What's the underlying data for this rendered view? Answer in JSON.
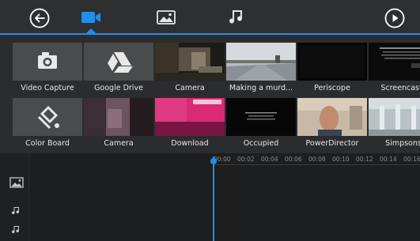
{
  "header": {
    "accent_color": "#1f8fe8",
    "back_icon": "arrow-left-circle-icon",
    "play_icon": "play-circle-icon",
    "tabs": [
      {
        "icon": "video-camera-icon",
        "active": true
      },
      {
        "icon": "image-icon",
        "active": false
      },
      {
        "icon": "music-note-icon",
        "active": false
      }
    ]
  },
  "library": {
    "items": [
      {
        "label": "Video Capture",
        "icon": "camera-icon"
      },
      {
        "label": "Google Drive",
        "icon": "google-drive-icon"
      },
      {
        "label": "Camera"
      },
      {
        "label": "Making a murd..."
      },
      {
        "label": "Periscope"
      },
      {
        "label": "Screencasts"
      },
      {
        "label": "Color Board",
        "icon": "color-board-icon"
      },
      {
        "label": "Camera"
      },
      {
        "label": "Download"
      },
      {
        "label": "Occupied"
      },
      {
        "label": "PowerDirector"
      },
      {
        "label": "Simpsons"
      }
    ],
    "screencast_thumb_text": "By \"Screencast shortcut\" you can capture the screen of the device"
  },
  "timeline": {
    "ticks": [
      "00:00",
      "00:02",
      "00:04",
      "00:06",
      "00:08",
      "00:10",
      "00:12",
      "00:14",
      "00:16"
    ],
    "tracks": [
      {
        "icon": "image-track-icon"
      },
      {
        "icon": "music-track-icon"
      },
      {
        "icon": "music-track-icon"
      }
    ]
  }
}
